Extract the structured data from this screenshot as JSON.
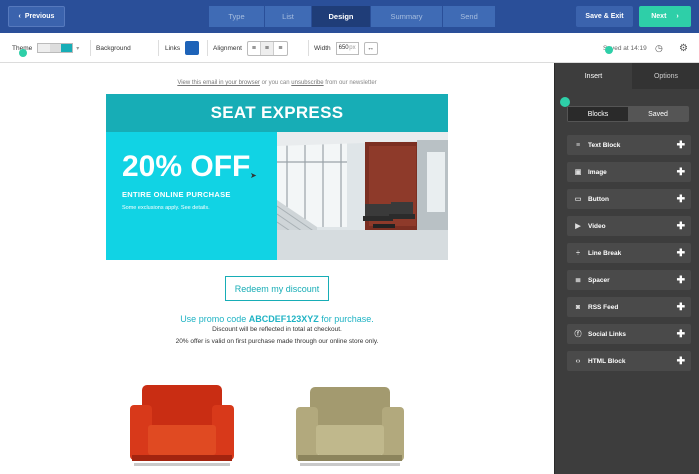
{
  "topnav": {
    "previous": "Previous",
    "steps": [
      "Type",
      "List",
      "Design",
      "Summary",
      "Send"
    ],
    "active_step": "Design",
    "save_exit": "Save & Exit",
    "next": "Next"
  },
  "toolbar": {
    "theme": "Theme",
    "background": "Background",
    "links": "Links",
    "alignment": "Alignment",
    "width": "Width",
    "width_value": "650",
    "width_unit": "px",
    "saved": "Saved at 14:19"
  },
  "email": {
    "pre_link1": "View this email in your browser",
    "pre_mid": " or you can ",
    "pre_link2": "unsubscribe",
    "pre_end": " from our newsletter",
    "header": "SEAT EXPRESS",
    "big": "20% OFF",
    "sub": "ENTIRE ONLINE PURCHASE",
    "fine": "Some exclusions apply. See details.",
    "button": "Redeem my discount",
    "promo_pre": "Use promo code ",
    "promo_code": "ABCDEF123XYZ",
    "promo_post": " for purchase.",
    "note1": "Discount will be reflected in total at checkout.",
    "note2": "20% offer is valid on first purchase made through our online store only."
  },
  "panel": {
    "tabs": [
      "Insert",
      "Options"
    ],
    "seg": [
      "Blocks",
      "Saved"
    ],
    "blocks": [
      {
        "label": "Text Block",
        "icon": "text-icon"
      },
      {
        "label": "Image",
        "icon": "image-icon"
      },
      {
        "label": "Button",
        "icon": "button-icon"
      },
      {
        "label": "Video",
        "icon": "video-icon"
      },
      {
        "label": "Line Break",
        "icon": "line-break-icon"
      },
      {
        "label": "Spacer",
        "icon": "spacer-icon"
      },
      {
        "label": "RSS Feed",
        "icon": "rss-icon"
      },
      {
        "label": "Social Links",
        "icon": "social-icon"
      },
      {
        "label": "HTML Block",
        "icon": "html-icon"
      }
    ]
  },
  "colors": {
    "nav": "#2a4f99",
    "accent": "#2ecfa8",
    "teal_header": "#17adb6",
    "cyan_hero": "#11d3e4",
    "panel": "#3d3d3d"
  }
}
